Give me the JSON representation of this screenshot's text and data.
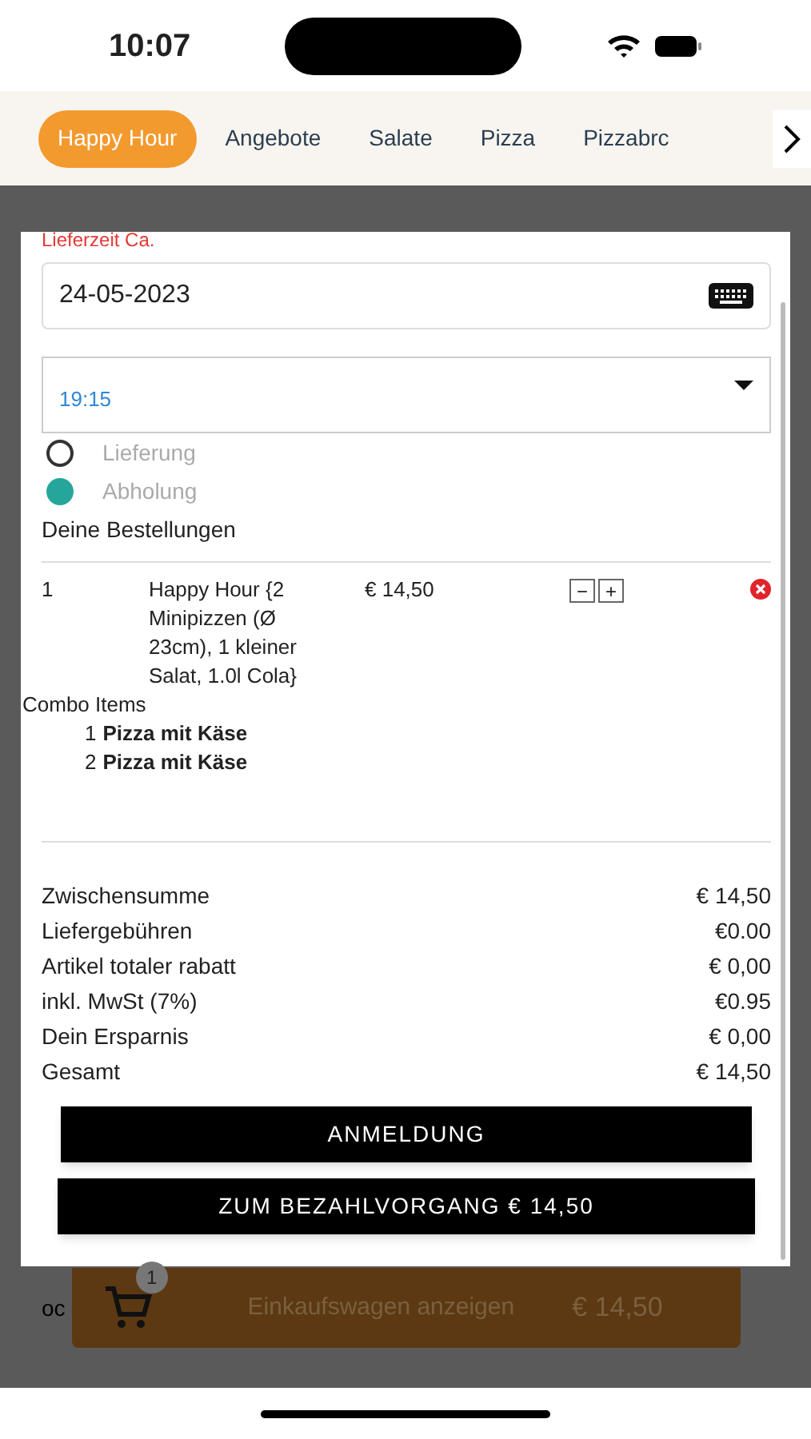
{
  "status_bar": {
    "time": "10:07"
  },
  "categories": [
    {
      "label": "Happy Hour",
      "selected": true
    },
    {
      "label": "Angebote",
      "selected": false
    },
    {
      "label": "Salate",
      "selected": false
    },
    {
      "label": "Pizza",
      "selected": false
    },
    {
      "label": "Pizzabrc",
      "selected": false
    }
  ],
  "modal": {
    "delivery_time_label": "Lieferzeit Ca.",
    "date_field": {
      "value": "24-05-2023"
    },
    "time_select": {
      "value": "19:15"
    },
    "options": [
      {
        "label": "Lieferung",
        "selected": false
      },
      {
        "label": "Abholung",
        "selected": true
      }
    ],
    "orders_heading": "Deine Bestellungen",
    "order_items": [
      {
        "qty": "1",
        "name": "Happy Hour {2 Minipizzen (Ø 23cm), 1 kleiner Salat, 1.0l Cola}",
        "price": "€ 14,50",
        "minus": "−",
        "plus": "+",
        "combo_heading": "Combo Items",
        "combo_items": [
          {
            "number": "1",
            "name": "Pizza mit Käse"
          },
          {
            "number": "2",
            "name": "Pizza mit Käse"
          }
        ]
      }
    ],
    "totals": [
      {
        "label": "Zwischensumme",
        "value": "€ 14,50"
      },
      {
        "label": "Liefergebühren",
        "value": "€0.00"
      },
      {
        "label": "Artikel totaler rabatt",
        "value": "€ 0,00"
      },
      {
        "label": "inkl. MwSt (7%)",
        "value": "€0.95"
      },
      {
        "label": "Dein Ersparnis",
        "value": "€ 0,00"
      },
      {
        "label": "Gesamt",
        "value": "€ 14,50"
      }
    ],
    "buttons": [
      "ANMELDUNG",
      "ZUM BEZAHLVORGANG € 14,50"
    ]
  },
  "background": {
    "cut_text": "oc",
    "cart_bar": {
      "count": "1",
      "label": "Einkaufswagen anzeigen",
      "total": "€ 14,50"
    }
  }
}
